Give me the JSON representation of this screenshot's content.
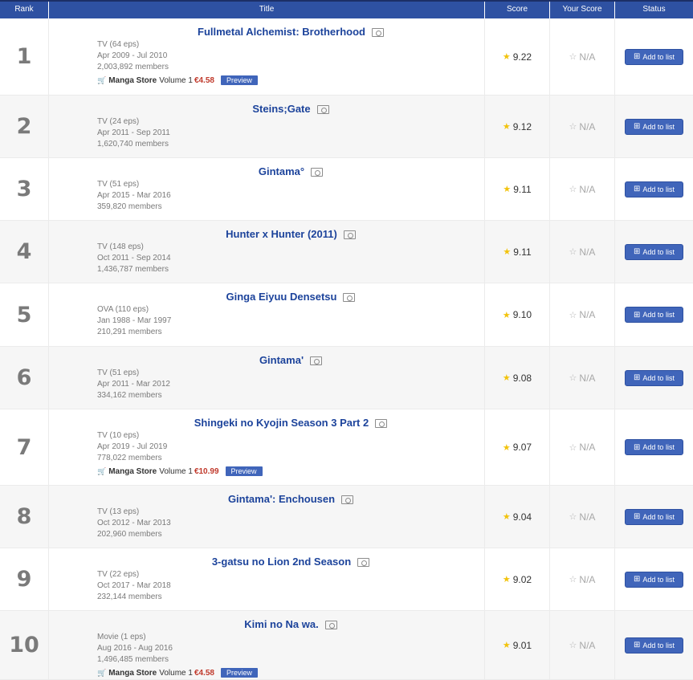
{
  "headers": {
    "rank": "Rank",
    "title": "Title",
    "score": "Score",
    "your_score": "Your Score",
    "status": "Status"
  },
  "add_label": "Add to list",
  "store_label": "Manga Store",
  "preview_label": "Preview",
  "na_label": "N/A",
  "colors": {
    "header_bg": "#2e51a2",
    "title_link": "#1c439b",
    "price": "#c0392b",
    "button": "#4065ba",
    "star": "#f2c30c"
  },
  "rows": [
    {
      "rank": "1",
      "title": "Fullmetal Alchemist: Brotherhood",
      "type": "TV (64 eps)",
      "dates": "Apr 2009 - Jul 2010",
      "members": "2,003,892 members",
      "score": "9.22",
      "store": {
        "volume": "Volume 1",
        "price": "€4.58"
      }
    },
    {
      "rank": "2",
      "title": "Steins;Gate",
      "type": "TV (24 eps)",
      "dates": "Apr 2011 - Sep 2011",
      "members": "1,620,740 members",
      "score": "9.12"
    },
    {
      "rank": "3",
      "title": "Gintama°",
      "type": "TV (51 eps)",
      "dates": "Apr 2015 - Mar 2016",
      "members": "359,820 members",
      "score": "9.11"
    },
    {
      "rank": "4",
      "title": "Hunter x Hunter (2011)",
      "type": "TV (148 eps)",
      "dates": "Oct 2011 - Sep 2014",
      "members": "1,436,787 members",
      "score": "9.11"
    },
    {
      "rank": "5",
      "title": "Ginga Eiyuu Densetsu",
      "type": "OVA (110 eps)",
      "dates": "Jan 1988 - Mar 1997",
      "members": "210,291 members",
      "score": "9.10"
    },
    {
      "rank": "6",
      "title": "Gintama'",
      "type": "TV (51 eps)",
      "dates": "Apr 2011 - Mar 2012",
      "members": "334,162 members",
      "score": "9.08"
    },
    {
      "rank": "7",
      "title": "Shingeki no Kyojin Season 3 Part 2",
      "type": "TV (10 eps)",
      "dates": "Apr 2019 - Jul 2019",
      "members": "778,022 members",
      "score": "9.07",
      "store": {
        "volume": "Volume 1",
        "price": "€10.99"
      }
    },
    {
      "rank": "8",
      "title": "Gintama': Enchousen",
      "type": "TV (13 eps)",
      "dates": "Oct 2012 - Mar 2013",
      "members": "202,960 members",
      "score": "9.04"
    },
    {
      "rank": "9",
      "title": "3-gatsu no Lion 2nd Season",
      "type": "TV (22 eps)",
      "dates": "Oct 2017 - Mar 2018",
      "members": "232,144 members",
      "score": "9.02"
    },
    {
      "rank": "10",
      "title": "Kimi no Na wa.",
      "type": "Movie (1 eps)",
      "dates": "Aug 2016 - Aug 2016",
      "members": "1,496,485 members",
      "score": "9.01",
      "store": {
        "volume": "Volume 1",
        "price": "€4.58"
      }
    }
  ]
}
